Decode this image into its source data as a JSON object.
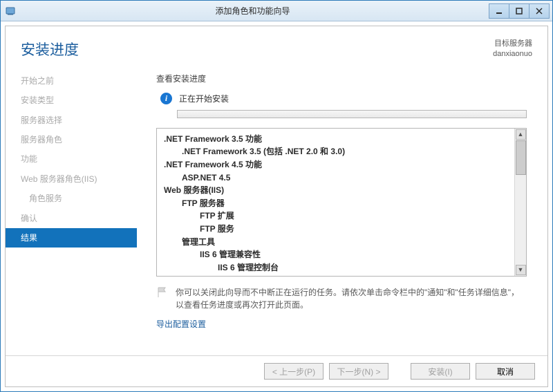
{
  "window": {
    "title": "添加角色和功能向导"
  },
  "header": {
    "heading": "安装进度",
    "target_label": "目标服务器",
    "target_value": "danxiaonuo"
  },
  "nav": {
    "items": [
      {
        "label": "开始之前",
        "indent": false,
        "selected": false
      },
      {
        "label": "安装类型",
        "indent": false,
        "selected": false
      },
      {
        "label": "服务器选择",
        "indent": false,
        "selected": false
      },
      {
        "label": "服务器角色",
        "indent": false,
        "selected": false
      },
      {
        "label": "功能",
        "indent": false,
        "selected": false
      },
      {
        "label": "Web 服务器角色(IIS)",
        "indent": false,
        "selected": false
      },
      {
        "label": "角色服务",
        "indent": true,
        "selected": false
      },
      {
        "label": "确认",
        "indent": false,
        "selected": false
      },
      {
        "label": "结果",
        "indent": false,
        "selected": true
      }
    ]
  },
  "pane": {
    "subhead": "查看安装进度",
    "status": "正在开始安装",
    "features": [
      {
        "text": ".NET Framework 3.5 功能",
        "level": 0
      },
      {
        "text": ".NET Framework 3.5 (包括 .NET 2.0 和 3.0)",
        "level": 1
      },
      {
        "text": ".NET Framework 4.5 功能",
        "level": 0
      },
      {
        "text": "ASP.NET 4.5",
        "level": 1
      },
      {
        "text": "Web 服务器(IIS)",
        "level": 0
      },
      {
        "text": "FTP 服务器",
        "level": 1
      },
      {
        "text": "FTP 扩展",
        "level": 2
      },
      {
        "text": "FTP 服务",
        "level": 2
      },
      {
        "text": "管理工具",
        "level": 1
      },
      {
        "text": "IIS 6 管理兼容性",
        "level": 2
      },
      {
        "text": "IIS 6 管理控制台",
        "level": 3
      }
    ],
    "hint": "你可以关闭此向导而不中断正在运行的任务。请依次单击命令栏中的\"通知\"和\"任务详细信息\"，以查看任务进度或再次打开此页面。",
    "export_link": "导出配置设置"
  },
  "footer": {
    "prev": "< 上一步(P)",
    "next": "下一步(N) >",
    "install": "安装(I)",
    "cancel": "取消"
  }
}
